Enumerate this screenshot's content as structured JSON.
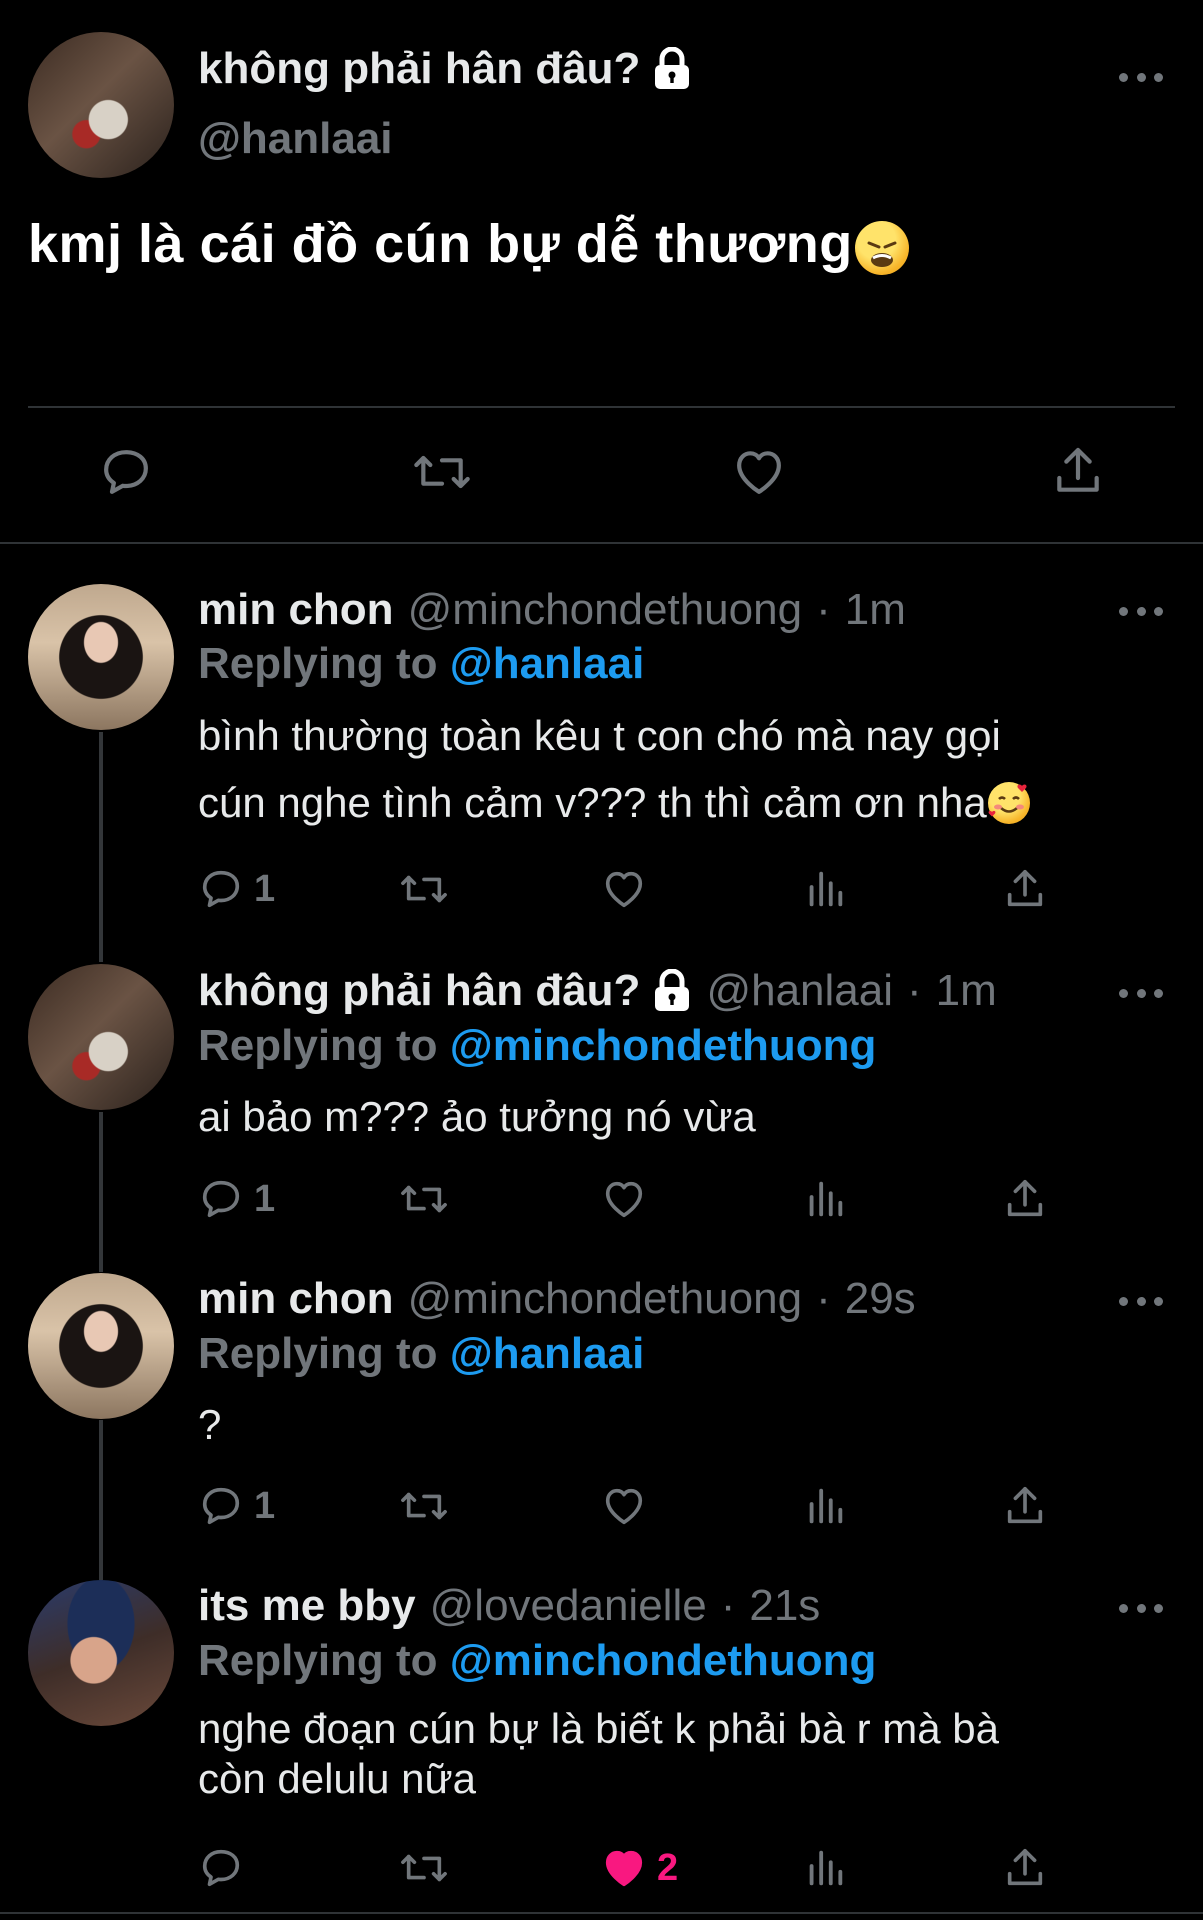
{
  "main_tweet": {
    "author_name": "không phải hân đâu?",
    "handle": "@hanlaai",
    "text": "kmj là cái đồ cún bự dễ thương",
    "text_emoji": "weary-face-emoji",
    "author_locked": true
  },
  "replies": [
    {
      "name": "min chon",
      "handle": "@minchondethuong",
      "time": "1m",
      "replying_label": "Replying to",
      "replying_to": "@hanlaai",
      "text_lines": [
        "bình thường toàn kêu t con chó mà nay gọi",
        "cún nghe tình cảm v??? th thì cảm ơn nha"
      ],
      "text_emoji": "smiling-face-with-hearts-emoji",
      "reply_count": "1",
      "like_count": "",
      "liked": false
    },
    {
      "name": "không phải hân đâu?",
      "handle": "@hanlaai",
      "time": "1m",
      "replying_label": "Replying to",
      "replying_to": "@minchondethuong",
      "text_lines": [
        "ai bảo m??? ảo tưởng nó vừa"
      ],
      "reply_count": "1",
      "like_count": "",
      "liked": false,
      "locked": true
    },
    {
      "name": "min chon",
      "handle": "@minchondethuong",
      "time": "29s",
      "replying_label": "Replying to",
      "replying_to": "@hanlaai",
      "text_lines": [
        "?"
      ],
      "reply_count": "1",
      "like_count": "",
      "liked": false
    },
    {
      "name": "its me bby",
      "handle": "@lovedanielle",
      "time": "21s",
      "replying_label": "Replying to",
      "replying_to": "@minchondethuong",
      "text_lines": [
        "nghe đoạn cún bự là biết k phải bà r mà bà",
        "còn delulu nữa"
      ],
      "reply_count": "",
      "like_count": "2",
      "liked": true
    }
  ],
  "colors": {
    "background": "#000000",
    "text": "#e7e9ea",
    "secondary": "#71767b",
    "mention": "#1d9bf0",
    "like": "#f91880",
    "divider": "#2f3336"
  },
  "time_separator": "·"
}
